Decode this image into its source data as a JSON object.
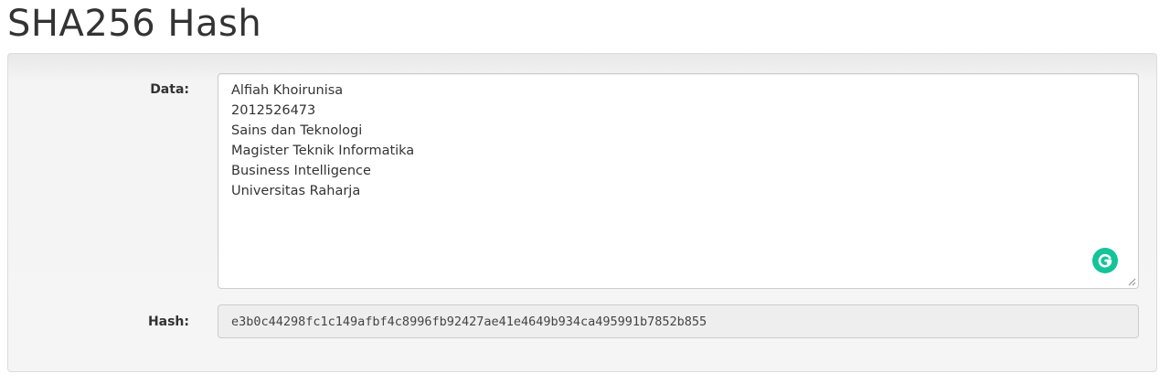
{
  "page": {
    "title": "SHA256 Hash"
  },
  "form": {
    "data_label": "Data:",
    "data_lines": [
      "Alfiah Khoirunisa",
      "2012526473",
      "Sains dan Teknologi",
      "Magister Teknik Informatika",
      "Business Intelligence",
      "Universitas Raharja"
    ],
    "hash_label": "Hash:",
    "hash_value": "e3b0c44298fc1c149afbf4c8996fb92427ae41e4649b934ca495991b7852b855"
  },
  "icons": {
    "grammarly": "grammarly-icon",
    "resize": "resize-handle-icon"
  },
  "colors": {
    "grammarly_green": "#15c39a",
    "panel_bg": "#f5f5f5",
    "readonly_bg": "#eeeeee"
  }
}
